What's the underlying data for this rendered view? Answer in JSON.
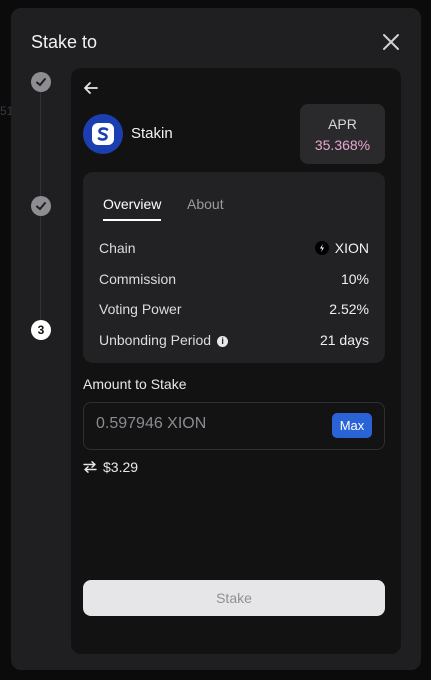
{
  "modal": {
    "title": "Stake to"
  },
  "stepper": {
    "steps": [
      "",
      "",
      "3"
    ]
  },
  "validator": {
    "name": "Stakin"
  },
  "apr": {
    "label": "APR",
    "value": "35.368%",
    "value_color": "#e9a7d2"
  },
  "tabs": [
    {
      "label": "Overview",
      "active": true
    },
    {
      "label": "About",
      "active": false
    }
  ],
  "overview": {
    "rows": [
      {
        "label": "Chain",
        "value": "XION"
      },
      {
        "label": "Commission",
        "value": "10%"
      },
      {
        "label": "Voting Power",
        "value": "2.52%"
      },
      {
        "label": "Unbonding Period",
        "value": "21 days"
      }
    ]
  },
  "amount": {
    "label": "Amount to Stake",
    "placeholder": "0.597946 XION",
    "max_label": "Max",
    "fiat_value": "$3.29"
  },
  "stake_button": {
    "label": "Stake"
  },
  "background": {
    "fragment": "51"
  },
  "colors": {
    "accent": "#2a63d6",
    "modal_bg": "#1f1f21",
    "panel_bg": "#121213"
  }
}
